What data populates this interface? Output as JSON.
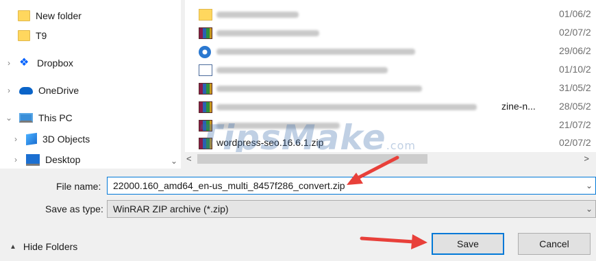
{
  "nav": {
    "items": [
      {
        "label": "New folder",
        "icon": "folder-icon"
      },
      {
        "label": "T9",
        "icon": "folder-icon"
      },
      {
        "label": "Dropbox",
        "icon": "dropbox-icon"
      },
      {
        "label": "OneDrive",
        "icon": "onedrive-icon"
      },
      {
        "label": "This PC",
        "icon": "computer-icon"
      },
      {
        "label": "3D Objects",
        "icon": "3d-objects-icon"
      },
      {
        "label": "Desktop",
        "icon": "desktop-icon"
      }
    ],
    "expand_glyph": "›",
    "collapse_glyph": "⌄",
    "scroll_down_glyph": "⌄"
  },
  "files": {
    "rows": [
      {
        "name": "",
        "date": "01/06/2",
        "icon": "folder-icon"
      },
      {
        "name": "",
        "date": "02/07/2",
        "icon": "winrar-icon"
      },
      {
        "name": "",
        "date": "29/06/2",
        "icon": "web-file-icon"
      },
      {
        "name": "",
        "date": "01/10/2",
        "icon": "document-icon"
      },
      {
        "name": "",
        "date": "31/05/2",
        "icon": "winrar-icon"
      },
      {
        "name": "zine-n...",
        "date": "28/05/2",
        "icon": "winrar-icon"
      },
      {
        "name": "",
        "date": "21/07/2",
        "icon": "winrar-icon"
      },
      {
        "name": "wordpress-seo.16.6.1.zip",
        "date": "02/07/2",
        "icon": "winrar-icon"
      }
    ]
  },
  "scrollbar": {
    "left_glyph": "<",
    "right_glyph": ">"
  },
  "watermark": {
    "text": "TipsMake",
    "suffix": ".com"
  },
  "form": {
    "file_name_label": "File name:",
    "file_name_value": "22000.160_amd64_en-us_multi_8457f286_convert.zip",
    "save_type_label": "Save as type:",
    "save_type_value": "WinRAR ZIP archive (*.zip)",
    "dropdown_glyph": "⌄"
  },
  "footer": {
    "hide_folders_label": "Hide Folders",
    "hide_glyph": "▲",
    "save_label": "Save",
    "cancel_label": "Cancel"
  },
  "colors": {
    "accent": "#0078d7",
    "arrow": "#e8403a"
  }
}
